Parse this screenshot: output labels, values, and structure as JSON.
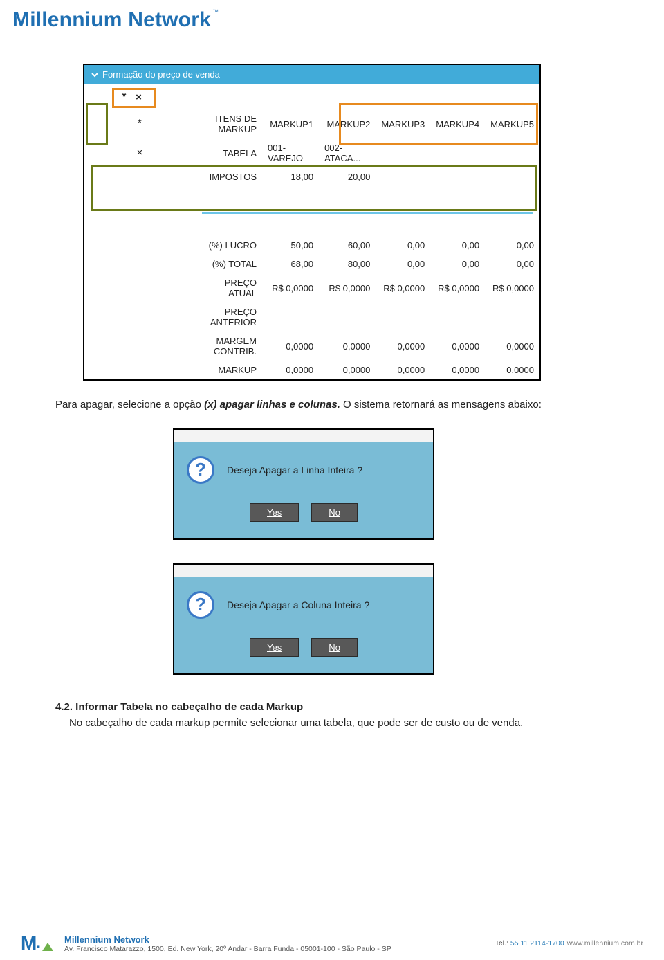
{
  "header": {
    "brand": "Millennium Network",
    "tm": "™"
  },
  "screenshot1": {
    "title": "Formação do preço de venda",
    "asterisk_btn": "*",
    "x_btn": "×",
    "columns": [
      "ITENS DE MARKUP",
      "MARKUP1",
      "MARKUP2",
      "MARKUP3",
      "MARKUP4",
      "MARKUP5"
    ],
    "row_tabela": [
      "TABELA",
      "001-VAREJO",
      "002-ATACA...",
      "",
      "",
      ""
    ],
    "row_impostos": [
      "IMPOSTOS",
      "18,00",
      "20,00",
      "",
      "",
      ""
    ],
    "row_lucro": [
      "(%) LUCRO",
      "50,00",
      "60,00",
      "0,00",
      "0,00",
      "0,00"
    ],
    "row_total": [
      "(%) TOTAL",
      "68,00",
      "80,00",
      "0,00",
      "0,00",
      "0,00"
    ],
    "row_preco_atual": [
      "PREÇO ATUAL",
      "R$ 0,0000",
      "R$ 0,0000",
      "R$ 0,0000",
      "R$ 0,0000",
      "R$ 0,0000"
    ],
    "row_preco_ant": [
      "PREÇO ANTERIOR",
      "",
      "",
      "",
      "",
      ""
    ],
    "row_margem": [
      "MARGEM CONTRIB.",
      "0,0000",
      "0,0000",
      "0,0000",
      "0,0000",
      "0,0000"
    ],
    "row_markup": [
      "MARKUP",
      "0,0000",
      "0,0000",
      "0,0000",
      "0,0000",
      "0,0000"
    ]
  },
  "para1_a": "Para apagar, selecione a opção ",
  "para1_b": "(x) apagar linhas e colunas.",
  "para1_c": " O sistema retornará as mensagens abaixo:",
  "dialog1": {
    "msg": "Deseja Apagar a Linha Inteira ?",
    "yes": "Yes",
    "no": "No"
  },
  "dialog2": {
    "msg": "Deseja Apagar a Coluna Inteira ?",
    "yes": "Yes",
    "no": "No"
  },
  "section": {
    "num_title": "4.2.  Informar Tabela no cabeçalho de cada Markup",
    "para": "No cabeçalho de cada markup permite selecionar uma tabela, que pode ser de custo ou de venda."
  },
  "footer": {
    "title": "Millennium Network",
    "addr": "Av. Francisco Matarazzo, 1500, Ed. New York, 20º Andar  - Barra Funda - 05001-100 - São Paulo - SP",
    "tel_lbl": "Tel.: ",
    "tel_num": "55 11 2114-1700",
    "url": "www.millennium.com.br"
  }
}
